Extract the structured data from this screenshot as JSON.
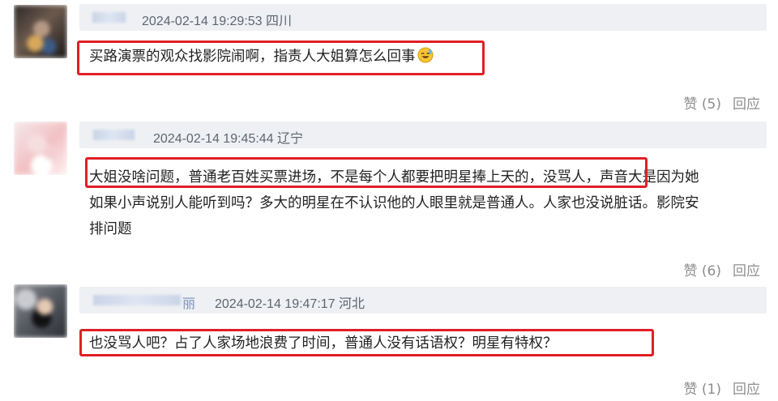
{
  "comments": [
    {
      "meta": "2024-02-14 19:29:53 四川",
      "username_tail": "",
      "text": "买路演票的观众找影院闹啊，指责人大姐算怎么回事",
      "emoji": "sweat-smile-emoji",
      "like_label": "赞 (5)",
      "reply_label": "回应"
    },
    {
      "meta": "2024-02-14 19:45:44 辽宁",
      "username_tail": "",
      "text_line1": "大姐没啥问题，普通老百姓买票进场，不是每个人都要把明星捧上天的，没骂人，声音大是因为她",
      "text_line2": "如果小声说别人能听到吗？多大的明星在不认识他的人眼里就是普通人。人家也没说脏话。影院安",
      "text_line3": "排问题",
      "like_label": "赞 (6)",
      "reply_label": "回应"
    },
    {
      "meta": "2024-02-14 19:47:17 河北",
      "username_tail": "丽",
      "text": "也没骂人吧？占了人家场地浪费了时间，普通人没有话语权？明星有特权？",
      "like_label": "赞 (1)",
      "reply_label": "回应"
    }
  ],
  "colors": {
    "highlight": "#e01f26",
    "meta_bar": "#eef0f3",
    "action_text": "#8e8e8e"
  }
}
